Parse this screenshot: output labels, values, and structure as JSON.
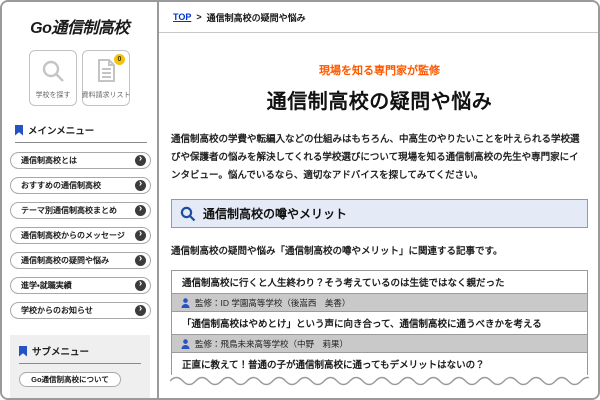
{
  "sidebar": {
    "logo": "Go通信制高校",
    "actions": [
      {
        "label": "学校を探す",
        "icon": "search-icon"
      },
      {
        "label": "資料請求リスト",
        "icon": "document-icon",
        "badge": "0"
      }
    ],
    "main_menu": {
      "title": "メインメニュー",
      "items": [
        "通信制高校とは",
        "おすすめの通信制高校",
        "テーマ別通信制高校まとめ",
        "通信制高校からのメッセージ",
        "通信制高校の疑問や悩み",
        "進学・就職実績",
        "学校からのお知らせ"
      ]
    },
    "sub_menu": {
      "title": "サブメニュー",
      "items": [
        "Go通信制高校について"
      ]
    }
  },
  "breadcrumb": {
    "home": "TOP",
    "separator": ">",
    "current": "通信制高校の疑問や悩み"
  },
  "main": {
    "tagline": "現場を知る専門家が監修",
    "title": "通信制高校の疑問や悩み",
    "intro": "通信制高校の学費や転編入などの仕組みはもちろん、中高生のやりたいことを叶えられる学校選びや保護者の悩みを解決してくれる学校選びについて現場を知る通信制高校の先生や専門家にインタビュー。悩んでいるなら、適切なアドバイスを探してみてください。",
    "section_title": "通信制高校の噂やメリット",
    "related_note": "通信制高校の疑問や悩み「通信制高校の噂やメリット」に関連する記事です。",
    "articles": [
      {
        "title": "通信制高校に行くと人生終わり？そう考えているのは生徒ではなく親だった",
        "supervisor": "監修：ID 学園高等学校（後嵩西　美香）"
      },
      {
        "title": "「通信制高校はやめとけ」という声に向き合って、通信制高校に通うべきかを考える",
        "supervisor": "監修：飛鳥未来高等学校（中野　莉果）"
      },
      {
        "title": "正直に教えて！普通の子が通信制高校に通ってもデメリットはないの？"
      }
    ]
  },
  "colors": {
    "accent_blue": "#2553c4",
    "orange": "#ff5a00",
    "link_blue": "#0033cc",
    "section_bg": "#e5ebf6",
    "supervisor_bg": "#c9c9c9",
    "border_gray": "#999999",
    "badge_yellow": "#f2c40f"
  }
}
